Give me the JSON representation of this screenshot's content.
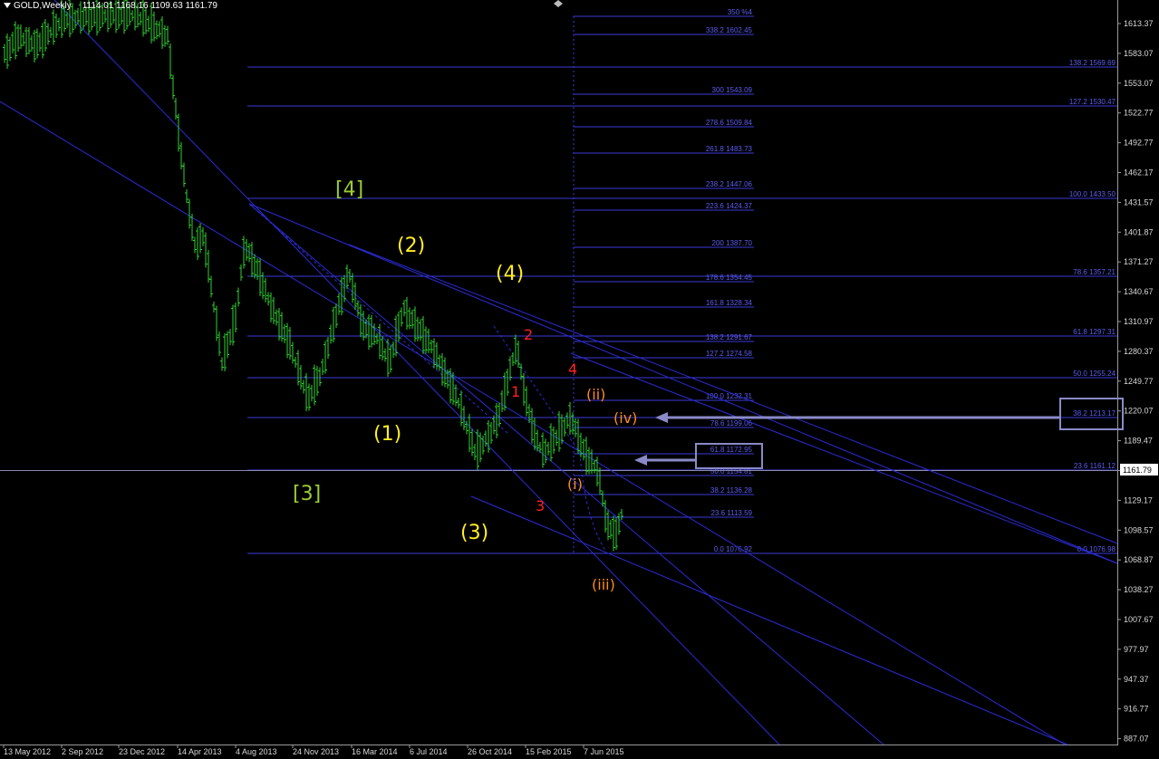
{
  "window": {
    "symbol": "GOLD,Weekly",
    "ohlc": "1114.01 1168.16 1109.63 1161.79"
  },
  "colors": {
    "background": "#000000",
    "candle": "#2fd22f",
    "trendline": "#2b2bd6",
    "fib": "#3a3ad8",
    "fib_text": "#5c5cf0",
    "axis_text": "#d8d8d8",
    "yellow_label": "#ffee22",
    "green_label": "#9acd32",
    "red_label": "#ff2020",
    "orange_label": "#ff8c1a",
    "arrow": "#8a8ac8"
  },
  "price_axis": {
    "labels": [
      "1613.37",
      "1583.07",
      "1553.07",
      "1522.77",
      "1492.77",
      "1462.17",
      "1431.57",
      "1401.87",
      "1371.27",
      "1340.67",
      "1310.97",
      "1280.37",
      "1249.77",
      "1220.07",
      "1189.47",
      "1159.77",
      "1129.17",
      "1098.57",
      "1068.87",
      "1038.27",
      "1007.67",
      "977.97",
      "947.37",
      "916.77",
      "887.07"
    ],
    "current_price": "1161.79"
  },
  "time_axis": {
    "labels": [
      "13 May 2012",
      "2 Sep 2012",
      "23 Dec 2012",
      "14 Apr 2013",
      "4 Aug 2013",
      "24 Nov 2013",
      "16 Mar 2014",
      "6 Jul 2014",
      "26 Oct 2014",
      "15 Feb 2015",
      "7 Jun 2015"
    ]
  },
  "fib_right": [
    "138.2  1569.69",
    "127.2  1530.47",
    "100.0  1433.50",
    "78.6  1357.21",
    "61.8  1297.31",
    "50.0  1255.24",
    "38.2  1213.17",
    "23.6  1161.12",
    "0.0  1076.98"
  ],
  "fib_mid": [
    "350  %4",
    "338.2  1602.45",
    "300  1543.09",
    "278.6  1509.84",
    "261.8  1483.73",
    "238.2  1447.06",
    "223.6  1424.37",
    "200  1387.70",
    "178.6  1354.45",
    "161.8  1328.34",
    "138.2  1291.67",
    "127.2  1274.58",
    "100.0  1232.31",
    "78.6  1199.06",
    "61.8  1172.95",
    "50.0  1154.81",
    "38.2  1136.28",
    "23.6  1113.59",
    "0.0  1076.92"
  ],
  "wave_labels": {
    "w4_green": "[4]",
    "w3_green": "[3]",
    "w2_yellow": "(2)",
    "w4_yellow": "(4)",
    "w1_yellow": "(1)",
    "w3_yellow": "(3)",
    "r2": "2",
    "r4": "4",
    "r1": "1",
    "r3": "3",
    "o_ii": "(ii)",
    "o_iv": "(iv)",
    "o_i": "(i)",
    "o_iii": "(iii)"
  }
}
